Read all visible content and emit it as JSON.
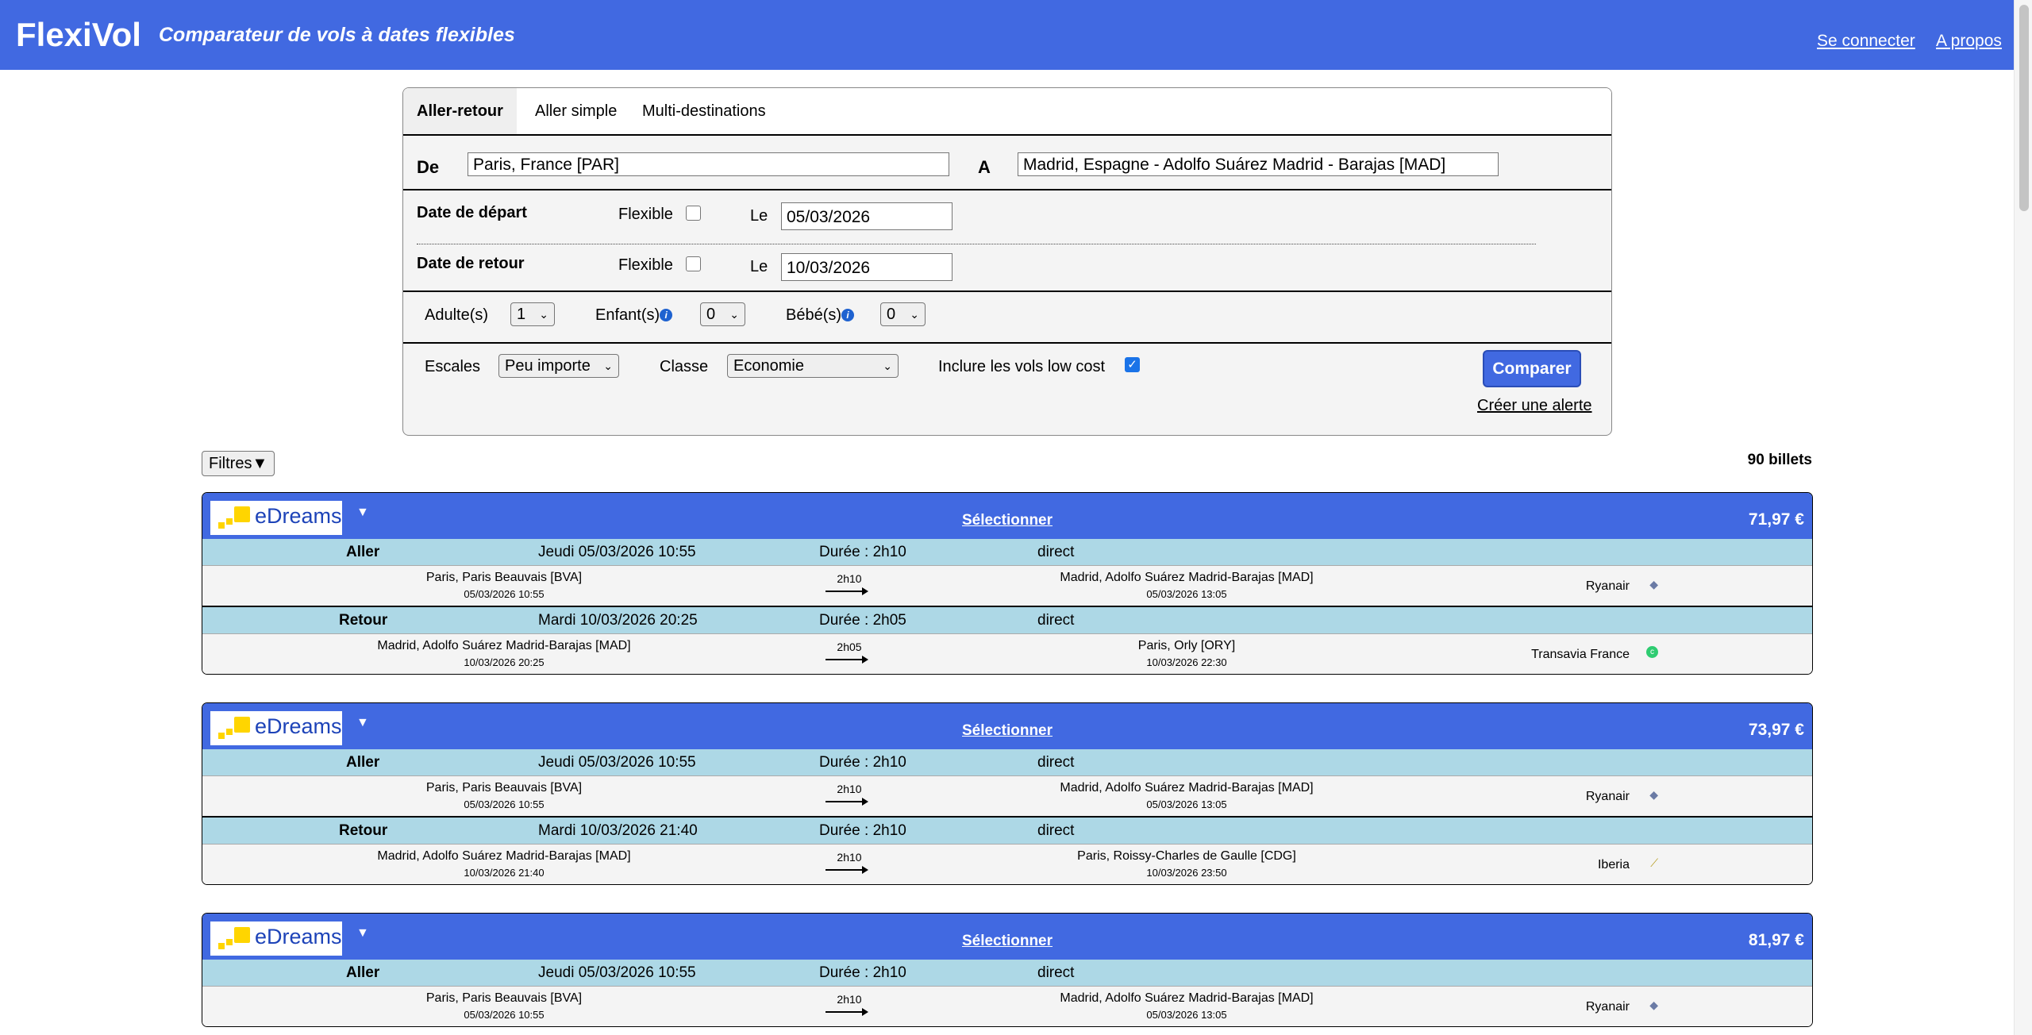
{
  "header": {
    "logo": "FlexiVol",
    "tagline": "Comparateur de vols à dates flexibles",
    "login": "Se connecter",
    "about": "A propos"
  },
  "form": {
    "tabs": [
      "Aller-retour",
      "Aller simple",
      "Multi-destinations"
    ],
    "from_label": "De",
    "from_value": "Paris, France [PAR]",
    "to_label": "A",
    "to_value": "Madrid, Espagne - Adolfo Suárez Madrid - Barajas [MAD]",
    "depart_label": "Date de départ",
    "return_label": "Date de retour",
    "flexible_label": "Flexible",
    "date_prefix": "Le",
    "depart_date": "05/03/2026",
    "return_date": "10/03/2026",
    "adults_label": "Adulte(s)",
    "adults_value": "1",
    "children_label": "Enfant(s)",
    "children_value": "0",
    "babies_label": "Bébé(s)",
    "babies_value": "0",
    "stops_label": "Escales",
    "stops_value": "Peu importe",
    "class_label": "Classe",
    "class_value": "Economie",
    "lowcost_label": "Inclure les vols low cost",
    "lowcost_checked": true,
    "compare_button": "Comparer",
    "alert_link": "Créer une alerte"
  },
  "results": {
    "filters_button": "Filtres▼",
    "count": "90 billets",
    "select_label": "Sélectionner",
    "aller_label": "Aller",
    "retour_label": "Retour",
    "cards": [
      {
        "vendor": "eDreams",
        "price": "71,97 €",
        "legs": [
          {
            "date": "Jeudi 05/03/2026 10:55",
            "duration": "Durée : 2h10",
            "stops": "direct",
            "from": "Paris, Paris Beauvais [BVA]",
            "from_time": "05/03/2026 10:55",
            "dur_short": "2h10",
            "to": "Madrid, Adolfo Suárez Madrid-Barajas [MAD]",
            "to_time": "05/03/2026 13:05",
            "airline": "Ryanair"
          },
          {
            "date": "Mardi 10/03/2026 20:25",
            "duration": "Durée : 2h05",
            "stops": "direct",
            "from": "Madrid, Adolfo Suárez Madrid-Barajas [MAD]",
            "from_time": "10/03/2026 20:25",
            "dur_short": "2h05",
            "to": "Paris, Orly [ORY]",
            "to_time": "10/03/2026 22:30",
            "airline": "Transavia France"
          }
        ]
      },
      {
        "vendor": "eDreams",
        "price": "73,97 €",
        "legs": [
          {
            "date": "Jeudi 05/03/2026 10:55",
            "duration": "Durée : 2h10",
            "stops": "direct",
            "from": "Paris, Paris Beauvais [BVA]",
            "from_time": "05/03/2026 10:55",
            "dur_short": "2h10",
            "to": "Madrid, Adolfo Suárez Madrid-Barajas [MAD]",
            "to_time": "05/03/2026 13:05",
            "airline": "Ryanair"
          },
          {
            "date": "Mardi 10/03/2026 21:40",
            "duration": "Durée : 2h10",
            "stops": "direct",
            "from": "Madrid, Adolfo Suárez Madrid-Barajas [MAD]",
            "from_time": "10/03/2026 21:40",
            "dur_short": "2h10",
            "to": "Paris, Roissy-Charles de Gaulle [CDG]",
            "to_time": "10/03/2026 23:50",
            "airline": "Iberia"
          }
        ]
      },
      {
        "vendor": "eDreams",
        "price": "81,97 €",
        "legs": [
          {
            "date": "Jeudi 05/03/2026 10:55",
            "duration": "Durée : 2h10",
            "stops": "direct",
            "from": "Paris, Paris Beauvais [BVA]",
            "from_time": "05/03/2026 10:55",
            "dur_short": "2h10",
            "to": "Madrid, Adolfo Suárez Madrid-Barajas [MAD]",
            "to_time": "05/03/2026 13:05",
            "airline": "Ryanair"
          }
        ]
      }
    ]
  },
  "colors": {
    "brand": "#4169e1",
    "leg_header": "#add8e6"
  }
}
